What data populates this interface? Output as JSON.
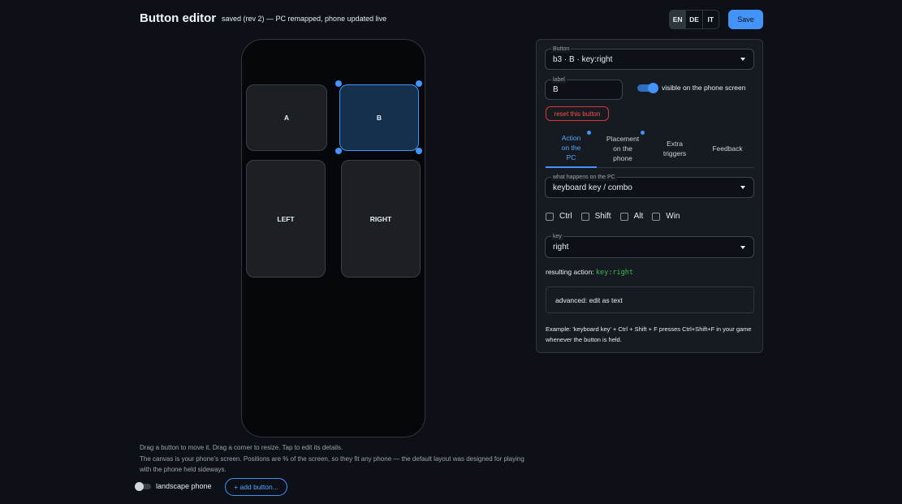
{
  "header": {
    "title": "Button editor",
    "status": "saved (rev 2) — PC remapped, phone updated live",
    "languages": [
      "EN",
      "DE",
      "IT"
    ],
    "active_language": "EN",
    "save_label": "Save"
  },
  "canvas": {
    "buttons": [
      {
        "label": "A"
      },
      {
        "label": "B"
      },
      {
        "label": "LEFT"
      },
      {
        "label": "RIGHT"
      }
    ],
    "selected_label": "B"
  },
  "help": {
    "line1": "Drag a button to move it. Drag a corner to resize. Tap to edit its details.",
    "line2": "The canvas is your phone's screen. Positions are % of the screen, so they fit any phone — the default layout was designed for playing with the phone held sideways.",
    "landscape_label": "landscape phone",
    "add_button_label": "+ add button..."
  },
  "panel": {
    "button_select": {
      "legend": "Button",
      "value": "b3 · B · key:right"
    },
    "label_field": {
      "legend": "label",
      "value": "B"
    },
    "visible_toggle_label": "visible on the phone screen",
    "reset_label": "reset this button",
    "tabs": [
      {
        "label": "Action on the PC"
      },
      {
        "label": "Placement on the phone"
      },
      {
        "label": "Extra triggers"
      },
      {
        "label": "Feedback"
      }
    ],
    "action_select": {
      "legend": "what happens on the PC",
      "value": "keyboard key / combo"
    },
    "modifiers": [
      "Ctrl",
      "Shift",
      "Alt",
      "Win"
    ],
    "key_select": {
      "legend": "key",
      "value": "right"
    },
    "result_label": "resulting action:",
    "result_value": "key:right",
    "advanced_label": "advanced: edit as text",
    "example": "Example: 'keyboard key' + Ctrl + Shift + F presses Ctrl+Shift+F in your game whenever the button is held."
  },
  "colors": {
    "accent": "#4493f8",
    "background": "#0d1117",
    "panel": "#161b22",
    "danger": "#f85149",
    "code": "#3fb950"
  }
}
